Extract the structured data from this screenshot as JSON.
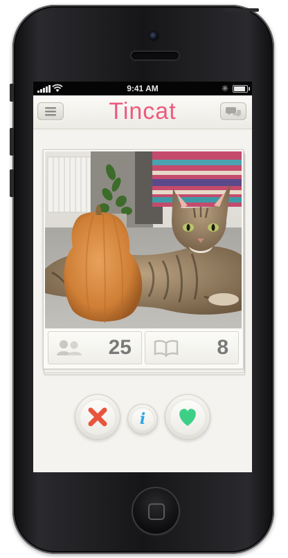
{
  "status_bar": {
    "time": "9:41 AM"
  },
  "app": {
    "title": "Tincat"
  },
  "navbar": {
    "menu_icon": "hamburger-menu-icon",
    "chat_icon": "speech-bubbles-icon"
  },
  "profile_card": {
    "photo_description_icon": "cat-and-pumpkin-photo",
    "stats": [
      {
        "icon": "people-icon",
        "value": "25"
      },
      {
        "icon": "book-icon",
        "value": "8"
      }
    ]
  },
  "actions": {
    "dislike_icon": "x-icon",
    "info_icon": "info-icon",
    "like_icon": "heart-icon",
    "info_glyph": "i"
  },
  "colors": {
    "title": "#ec5a7c",
    "dislike": "#e8553c",
    "like": "#3ecf86",
    "info": "#2aa7e6"
  }
}
